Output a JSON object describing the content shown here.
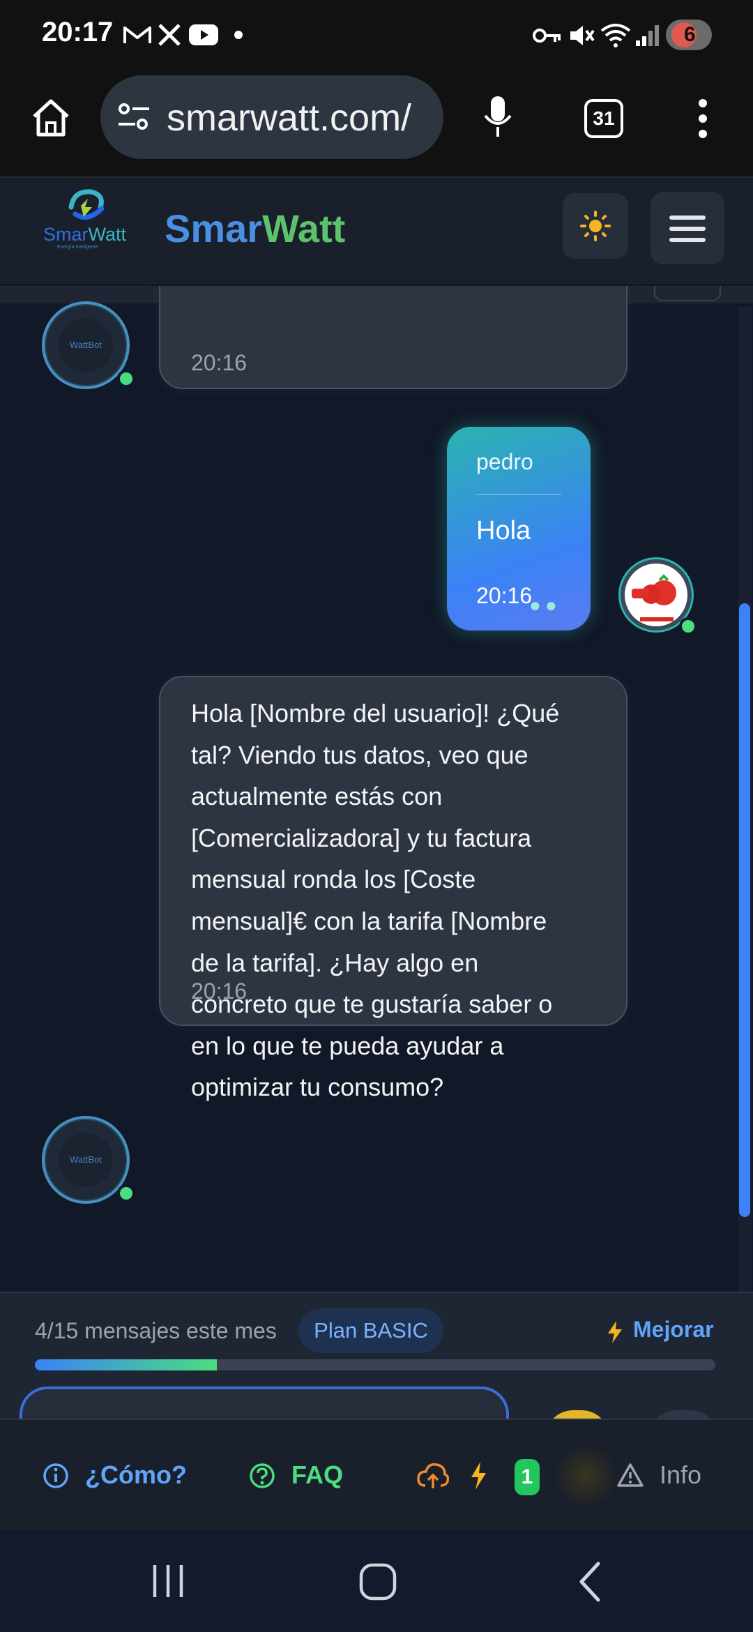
{
  "status_bar": {
    "time": "20:17",
    "notification_icons": [
      "gmail-icon",
      "x-icon",
      "youtube-icon",
      "dot-icon"
    ],
    "system_icons": [
      "key-icon",
      "mute-icon",
      "wifi-icon",
      "signal-icon"
    ],
    "notification_count": "6"
  },
  "browser": {
    "url": "smarwatt.com/",
    "tab_count": "31"
  },
  "app_header": {
    "logo_text": "SmarWatt",
    "logo_subtext": "Energía Inteligente",
    "brand_part1": "Smar",
    "brand_part2": "Watt"
  },
  "chat": {
    "messages": [
      {
        "sender": "bot",
        "avatar_text": "WattBot",
        "time": "20:16"
      },
      {
        "sender": "user",
        "name": "pedro",
        "text": "Hola",
        "time": "20:16"
      },
      {
        "sender": "bot",
        "avatar_text": "WattBot",
        "lines": [
          "Hola [Nombre del usuario]! ¿Qué",
          "tal? Viendo tus datos, veo que",
          "actualmente estás con",
          "[Comercializadora] y tu factura",
          "mensual ronda los [Coste",
          "mensual]€ con la tarifa [Nombre",
          "de la tarifa]. ¿Hay algo en",
          "concreto que te gustaría saber o",
          "en lo que te pueda ayudar a",
          "optimizar tu consumo?"
        ],
        "time": "20:16"
      }
    ]
  },
  "usage": {
    "messages_text": "4/15 mensajes este mes",
    "plan_label": "Plan BASIC",
    "upgrade_label": "Mejorar",
    "progress_fraction": 0.267
  },
  "bottom_bar": {
    "how_label": "¿Cómo?",
    "faq_label": "FAQ",
    "badge_count": "1",
    "info_label": "Info"
  },
  "colors": {
    "accent_blue": "#3b82f6",
    "accent_green": "#4ade80",
    "brand_blue": "#4a90e2",
    "brand_green": "#5cc26b",
    "background": "#111827"
  }
}
